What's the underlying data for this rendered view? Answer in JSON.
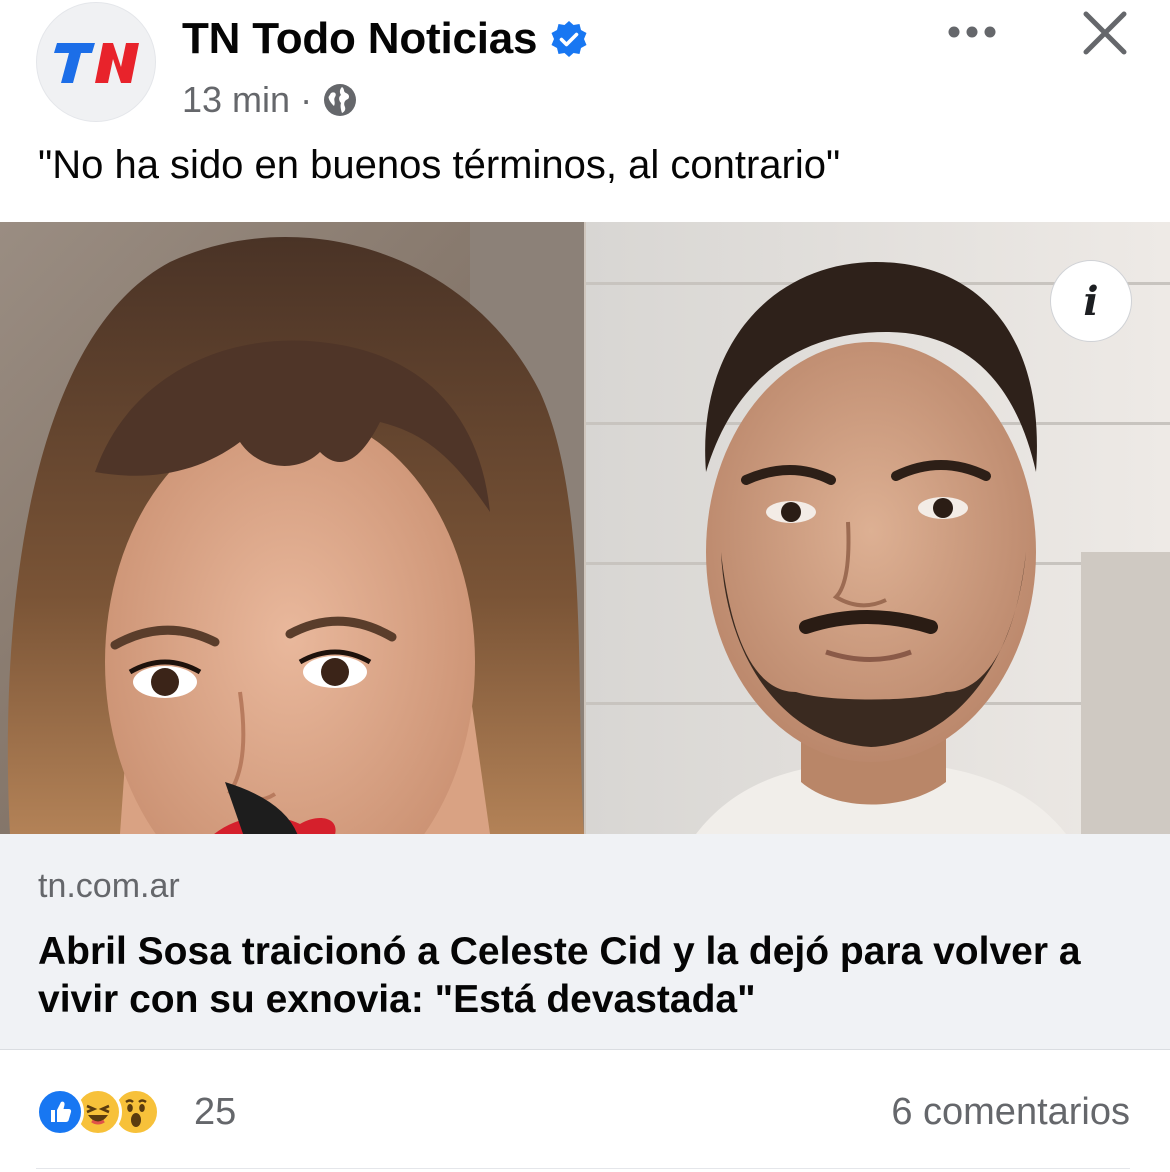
{
  "post": {
    "author": "TN Todo Noticias",
    "time": "13 min",
    "separator": "·",
    "caption": "\"No ha sido en buenos términos, al contrario\"",
    "logo_text": "TN"
  },
  "link": {
    "domain": "tn.com.ar",
    "headline": "Abril Sosa traicionó a Celeste Cid y la dejó para volver a vivir con su exnovia: \"Está devastada\"",
    "info_label": "i"
  },
  "engagement": {
    "reaction_count": "25",
    "comments": "6 comentarios",
    "reactions": [
      "like-icon",
      "haha-icon",
      "wow-icon"
    ]
  },
  "icons": {
    "verified": "verified-badge-icon",
    "audience": "globe-icon",
    "more": "more-options-icon",
    "close": "close-icon"
  },
  "colors": {
    "brand_red": "#e8232b",
    "brand_blue": "#1c6ee8",
    "facebook_blue": "#1877f2",
    "secondary_text": "#65676b",
    "card_bg": "#f0f2f5"
  }
}
